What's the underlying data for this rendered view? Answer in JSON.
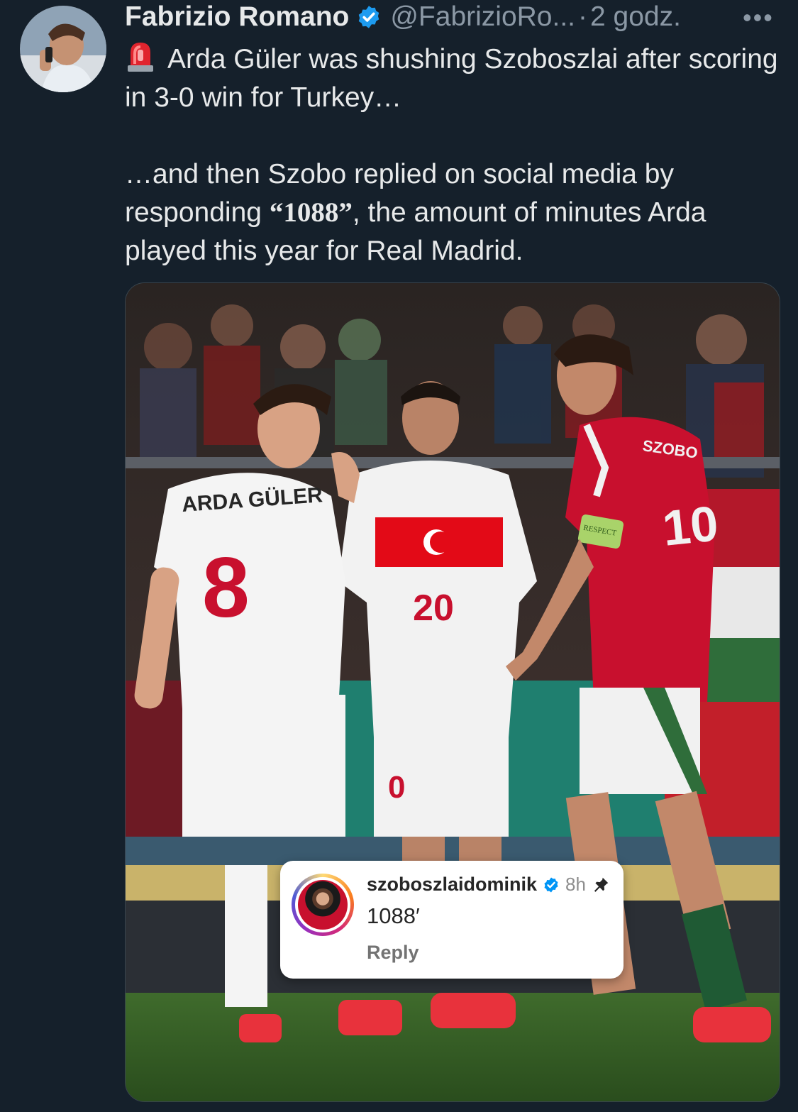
{
  "tweet": {
    "author_name": "Fabrizio Romano",
    "handle": "@FabrizioRo...",
    "separator": "·",
    "time": "2 godz.",
    "more": "•••",
    "line1_text": "Arda Güler was shushing Szoboszlai after scoring in 3-0 win for Turkey…",
    "line2_prefix": "…and then Szobo replied on social media by responding ",
    "line2_number": "“1088”",
    "line2_suffix": ", the amount of minutes Arda played this year for Real Madrid.",
    "icons": [
      "verified-badge-icon",
      "siren-emoji-icon",
      "more-options-icon"
    ]
  },
  "photo": {
    "jersey_left": "ARDA GÜLER",
    "number_left": "8",
    "number_center": "20",
    "number_right": "10",
    "shorts_number": "0",
    "armband": "RESPECT",
    "jersey_right_name": "SZOBO"
  },
  "instagram_comment": {
    "username": "szoboszlaidominik",
    "time": "8h",
    "comment": "1088′",
    "reply_label": "Reply",
    "icons": [
      "instagram-verified-icon",
      "pin-icon"
    ]
  },
  "colors": {
    "background": "#15202b",
    "text": "#e7e9ea",
    "secondary": "#8b98a5",
    "verified": "#1d9bf0",
    "turkey_red": "#e30a17",
    "hungary_red": "#c8102e"
  }
}
